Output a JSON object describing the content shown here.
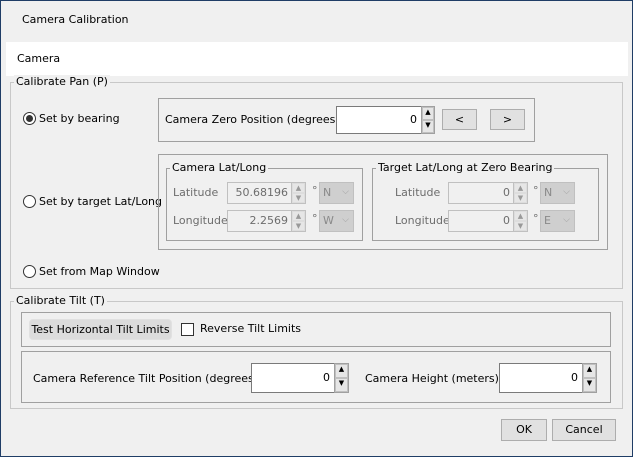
{
  "window": {
    "title": "Camera Calibration"
  },
  "header": {
    "label": "Camera"
  },
  "pan": {
    "legend": "Calibrate Pan (P)",
    "options": [
      {
        "label": "Set by bearing",
        "selected": true
      },
      {
        "label": "Set by target Lat/Long",
        "selected": false
      },
      {
        "label": "Set from Map Window",
        "selected": false
      }
    ],
    "zero_label": "Camera Zero Position (degrees) :",
    "zero_value": "0",
    "prev_label": "<",
    "next_label": ">",
    "camera_group": {
      "legend": "Camera Lat/Long",
      "lat_label": "Latitude",
      "lat_value": "50.68196",
      "lat_dir": "N",
      "lon_label": "Longitude",
      "lon_value": "2.2569",
      "lon_dir": "W"
    },
    "target_group": {
      "legend": "Target Lat/Long at Zero Bearing",
      "lat_label": "Latitude",
      "lat_value": "0",
      "lat_dir": "N",
      "lon_label": "Longitude",
      "lon_value": "0",
      "lon_dir": "E"
    },
    "degree": "°"
  },
  "tilt": {
    "legend": "Calibrate Tilt (T)",
    "test_label": "Test Horizontal Tilt Limits",
    "reverse_label": "Reverse Tilt Limits",
    "reverse_checked": false,
    "ref_label": "Camera Reference Tilt Position (degrees) :",
    "ref_value": "0",
    "height_label": "Camera Height (meters) :",
    "height_value": "0"
  },
  "footer": {
    "ok": "OK",
    "cancel": "Cancel"
  },
  "colors": {
    "window_border": "#1f3d66"
  }
}
